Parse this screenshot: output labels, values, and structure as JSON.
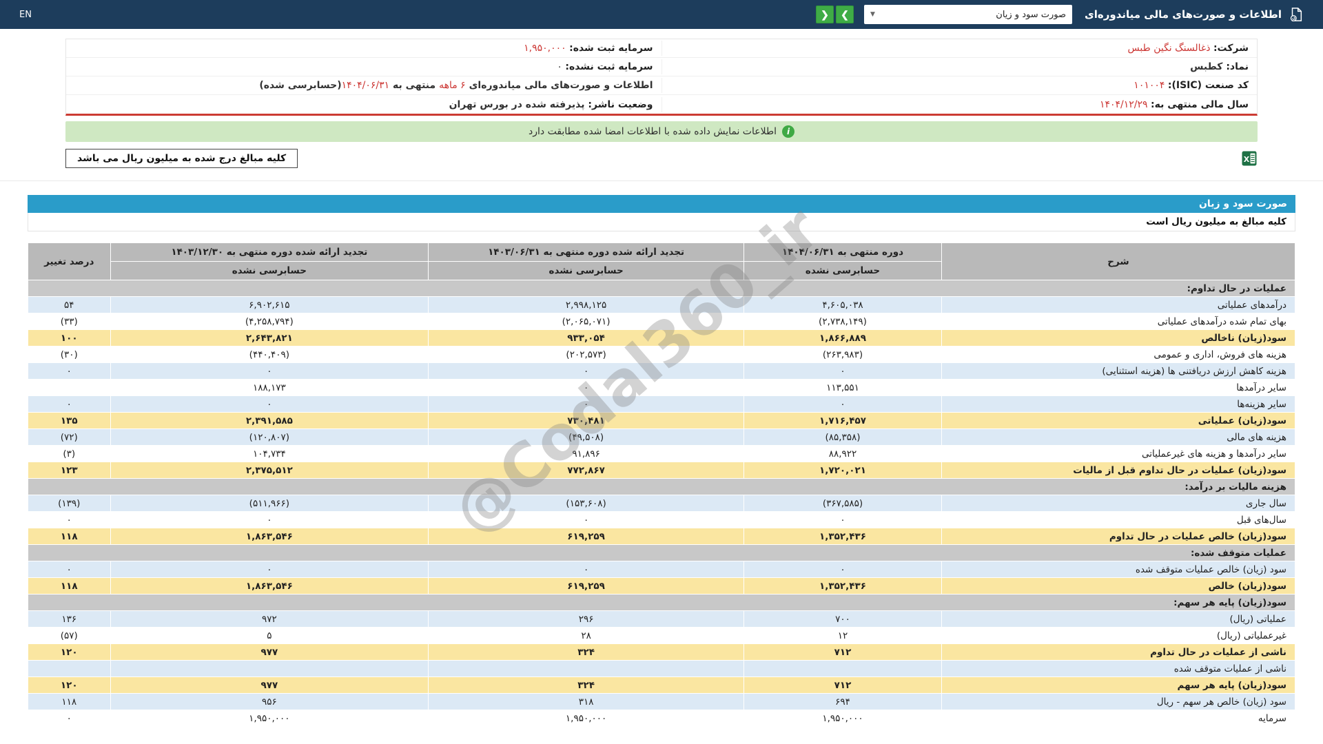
{
  "topbar": {
    "title": "اطلاعات و صورت‌های مالی میاندوره‌ای",
    "report_selector_value": "صورت سود و زیان",
    "nav_forward": "❯",
    "nav_back": "❮",
    "language": "EN"
  },
  "company": {
    "rows": [
      {
        "right": {
          "label": "شرکت:",
          "value": " ذغالسنگ نگین طبس",
          "red": true
        },
        "left": {
          "label": "سرمایه ثبت شده:",
          "value": " ۱,۹۵۰,۰۰۰",
          "red": true
        }
      },
      {
        "right": {
          "label": "نماد:",
          "value": " کطبس",
          "bold": true
        },
        "left": {
          "label": "سرمایه ثبت نشده:",
          "value": " ۰"
        }
      },
      {
        "right": {
          "label": "کد صنعت (ISIC):",
          "value": " ۱۰۱۰۰۴",
          "red": true
        },
        "left": {
          "parts": [
            {
              "text": "اطلاعات و صورت‌های مالی میاندوره‌ای ",
              "bold": true
            },
            {
              "text": "۶ ماهه",
              "red": true
            },
            {
              "text": " منتهی به ",
              "bold": true
            },
            {
              "text": "۱۴۰۴/۰۶/۳۱",
              "red": true
            },
            {
              "text": "(حسابرسی شده)",
              "bold": true
            }
          ]
        }
      },
      {
        "right": {
          "label": "سال مالی منتهی به:",
          "value": " ۱۴۰۴/۱۲/۲۹",
          "red": true
        },
        "left": {
          "label": "وضعیت ناشر:",
          "value": " پذیرفته شده در بورس تهران",
          "bold": true
        }
      }
    ]
  },
  "banner": {
    "text": "اطلاعات نمایش داده شده با اطلاعات امضا شده مطابقت دارد"
  },
  "notes": {
    "amount_note": "کلیه مبالغ درج شده به میلیون ریال می باشد"
  },
  "statement": {
    "title": "صورت سود و زیان",
    "unit_note": "کلیه مبالغ به میلیون ریال است",
    "watermark": "@Codal360_ir",
    "header": {
      "desc": "شرح",
      "change": "درصد تغییر",
      "periods": [
        {
          "title": "دوره منتهی به ۱۴۰۴/۰۶/۳۱",
          "audit": "حسابرسی نشده"
        },
        {
          "title": "تجدید ارائه شده دوره منتهی به ۱۴۰۳/۰۶/۳۱",
          "audit": "حسابرسی نشده"
        },
        {
          "title": "تجدید ارائه شده دوره منتهی به ۱۴۰۳/۱۲/۳۰",
          "audit": "حسابرسی نشده"
        }
      ]
    },
    "rows": [
      {
        "type": "section",
        "label": "عملیات در حال تداوم:"
      },
      {
        "type": "data",
        "style": "blue",
        "label": "درآمدهای عملیاتی",
        "values": [
          "۴,۶۰۵,۰۳۸",
          "۲,۹۹۸,۱۲۵",
          "۶,۹۰۲,۶۱۵"
        ],
        "change": "۵۴"
      },
      {
        "type": "data",
        "style": "white",
        "label": "بهای تمام شده درآمدهای عملیاتی",
        "values": [
          "(۲,۷۳۸,۱۴۹)",
          "(۲,۰۶۵,۰۷۱)",
          "(۴,۲۵۸,۷۹۴)"
        ],
        "change": "(۳۳)"
      },
      {
        "type": "data",
        "style": "yellow",
        "label": "سود(زیان) ناخالص",
        "values": [
          "۱,۸۶۶,۸۸۹",
          "۹۳۳,۰۵۴",
          "۲,۶۴۳,۸۲۱"
        ],
        "change": "۱۰۰"
      },
      {
        "type": "data",
        "style": "white",
        "label": "هزینه های فروش، اداری و عمومی",
        "values": [
          "(۲۶۳,۹۸۳)",
          "(۲۰۲,۵۷۳)",
          "(۴۴۰,۴۰۹)"
        ],
        "change": "(۳۰)"
      },
      {
        "type": "data",
        "style": "blue",
        "label": "هزینه کاهش ارزش دریافتنی ها (هزینه استثنایی)",
        "values": [
          "۰",
          "۰",
          "۰"
        ],
        "change": "۰"
      },
      {
        "type": "data",
        "style": "white",
        "label": "سایر درآمدها",
        "values": [
          "۱۱۳,۵۵۱",
          "۰",
          "۱۸۸,۱۷۳"
        ],
        "change": ""
      },
      {
        "type": "data",
        "style": "blue",
        "label": "سایر هزینه‌ها",
        "values": [
          "۰",
          "۰",
          "۰"
        ],
        "change": "۰"
      },
      {
        "type": "data",
        "style": "yellow",
        "label": "سود(زیان) عملیاتی",
        "values": [
          "۱,۷۱۶,۴۵۷",
          "۷۳۰,۴۸۱",
          "۲,۳۹۱,۵۸۵"
        ],
        "change": "۱۳۵"
      },
      {
        "type": "data",
        "style": "blue",
        "label": "هزینه های مالی",
        "values": [
          "(۸۵,۳۵۸)",
          "(۴۹,۵۰۸)",
          "(۱۲۰,۸۰۷)"
        ],
        "change": "(۷۲)"
      },
      {
        "type": "data",
        "style": "white",
        "label": "سایر درآمدها و هزینه های غیرعملیاتی",
        "values": [
          "۸۸,۹۲۲",
          "۹۱,۸۹۶",
          "۱۰۴,۷۳۴"
        ],
        "change": "(۳)"
      },
      {
        "type": "data",
        "style": "yellow",
        "label": "سود(زیان) عملیات در حال تداوم قبل از مالیات",
        "values": [
          "۱,۷۲۰,۰۲۱",
          "۷۷۲,۸۶۷",
          "۲,۳۷۵,۵۱۲"
        ],
        "change": "۱۲۳"
      },
      {
        "type": "section",
        "label": "هزینه مالیات بر درآمد:"
      },
      {
        "type": "data",
        "style": "blue",
        "label": "سال جاری",
        "values": [
          "(۳۶۷,۵۸۵)",
          "(۱۵۳,۶۰۸)",
          "(۵۱۱,۹۶۶)"
        ],
        "change": "(۱۳۹)"
      },
      {
        "type": "data",
        "style": "white",
        "label": "سال‌های قبل",
        "values": [
          "۰",
          "۰",
          "۰"
        ],
        "change": "۰"
      },
      {
        "type": "data",
        "style": "yellow",
        "label": "سود(زیان) خالص عملیات در حال تداوم",
        "values": [
          "۱,۳۵۲,۴۳۶",
          "۶۱۹,۲۵۹",
          "۱,۸۶۳,۵۴۶"
        ],
        "change": "۱۱۸"
      },
      {
        "type": "section",
        "label": "عملیات متوقف شده:"
      },
      {
        "type": "data",
        "style": "blue",
        "label": "سود (زیان) خالص عملیات متوقف شده",
        "values": [
          "۰",
          "۰",
          "۰"
        ],
        "change": "۰"
      },
      {
        "type": "data",
        "style": "yellow",
        "label": "سود(زیان) خالص",
        "values": [
          "۱,۳۵۲,۴۳۶",
          "۶۱۹,۲۵۹",
          "۱,۸۶۳,۵۴۶"
        ],
        "change": "۱۱۸"
      },
      {
        "type": "section",
        "label": "سود(زیان) پایه هر سهم:"
      },
      {
        "type": "data",
        "style": "blue",
        "label": "عملیاتی (ریال)",
        "values": [
          "۷۰۰",
          "۲۹۶",
          "۹۷۲"
        ],
        "change": "۱۳۶"
      },
      {
        "type": "data",
        "style": "white",
        "label": "غیرعملیاتی (ریال)",
        "values": [
          "۱۲",
          "۲۸",
          "۵"
        ],
        "change": "(۵۷)"
      },
      {
        "type": "data",
        "style": "yellow",
        "label": "ناشی از عملیات در حال تداوم",
        "values": [
          "۷۱۲",
          "۳۲۴",
          "۹۷۷"
        ],
        "change": "۱۲۰"
      },
      {
        "type": "data",
        "style": "blue",
        "label": "ناشی از عملیات متوقف شده",
        "values": [
          "",
          "",
          ""
        ],
        "change": ""
      },
      {
        "type": "data",
        "style": "yellow",
        "label": "سود(زیان) پایه هر سهم",
        "values": [
          "۷۱۲",
          "۳۲۴",
          "۹۷۷"
        ],
        "change": "۱۲۰"
      },
      {
        "type": "data",
        "style": "blue",
        "label": "سود (زیان) خالص هر سهم - ریال",
        "values": [
          "۶۹۴",
          "۳۱۸",
          "۹۵۶"
        ],
        "change": "۱۱۸"
      },
      {
        "type": "data",
        "style": "white",
        "label": "سرمایه",
        "values": [
          "۱,۹۵۰,۰۰۰",
          "۱,۹۵۰,۰۰۰",
          "۱,۹۵۰,۰۰۰"
        ],
        "change": "۰"
      }
    ]
  }
}
